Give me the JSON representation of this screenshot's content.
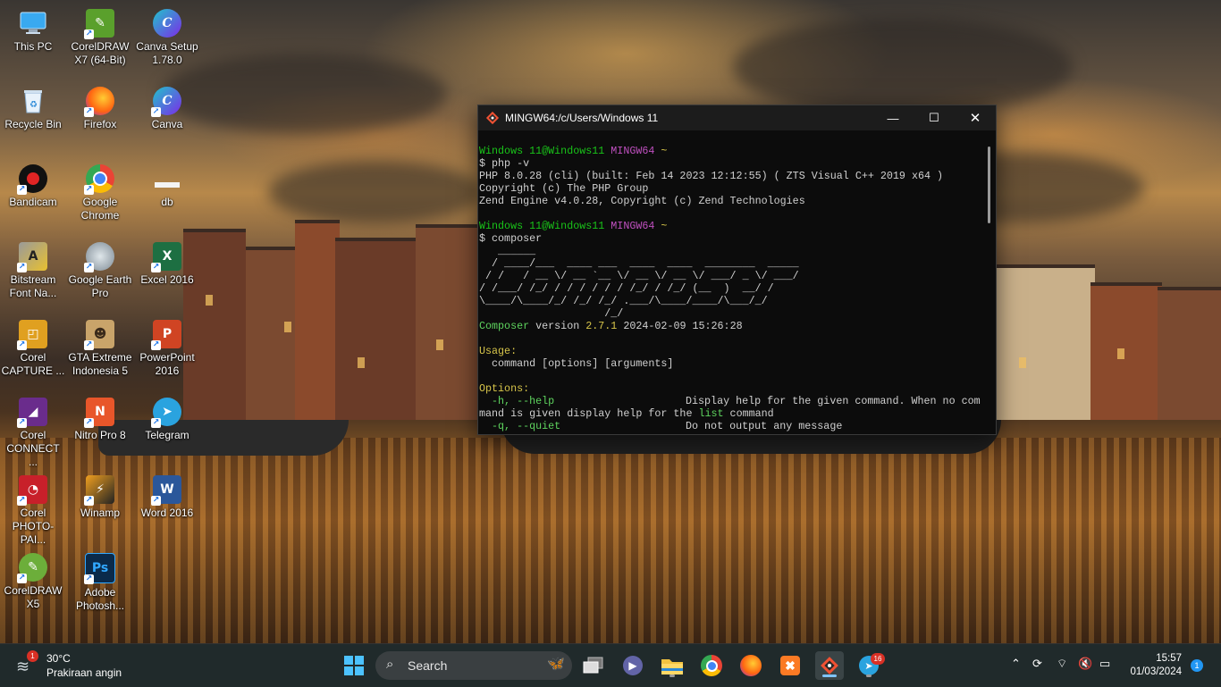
{
  "desktop": {
    "icons": [
      {
        "label": "This PC",
        "icon": "monitor-icon"
      },
      {
        "label": "CorelDRAW X7 (64-Bit)",
        "icon": "coreldraw-icon"
      },
      {
        "label": "Canva Setup 1.78.0",
        "icon": "canva-icon"
      },
      {
        "label": "Recycle Bin",
        "icon": "recycle-bin-icon"
      },
      {
        "label": "Firefox",
        "icon": "firefox-icon"
      },
      {
        "label": "Canva",
        "icon": "canva-icon"
      },
      {
        "label": "Bandicam",
        "icon": "bandicam-icon"
      },
      {
        "label": "Google Chrome",
        "icon": "chrome-icon"
      },
      {
        "label": "db",
        "icon": "file-icon"
      },
      {
        "label": "Bitstream Font Na...",
        "icon": "bitstream-icon"
      },
      {
        "label": "Google Earth Pro",
        "icon": "google-earth-icon"
      },
      {
        "label": "Excel 2016",
        "icon": "excel-icon"
      },
      {
        "label": "Corel CAPTURE ...",
        "icon": "corel-capture-icon"
      },
      {
        "label": "GTA Extreme Indonesia 5",
        "icon": "gta-icon"
      },
      {
        "label": "PowerPoint 2016",
        "icon": "powerpoint-icon"
      },
      {
        "label": "Corel CONNECT ...",
        "icon": "corel-connect-icon"
      },
      {
        "label": "Nitro Pro 8",
        "icon": "nitro-icon"
      },
      {
        "label": "Telegram",
        "icon": "telegram-icon"
      },
      {
        "label": "Corel PHOTO-PAI...",
        "icon": "corel-photopaint-icon"
      },
      {
        "label": "Winamp",
        "icon": "winamp-icon"
      },
      {
        "label": "Word 2016",
        "icon": "word-icon"
      },
      {
        "label": "CorelDRAW X5",
        "icon": "coreldraw-icon"
      },
      {
        "label": "Adobe Photosh...",
        "icon": "photoshop-icon"
      }
    ]
  },
  "terminal": {
    "title": "MINGW64:/c/Users/Windows 11",
    "prompt_user": "Windows 11@Windows11",
    "prompt_env": "MINGW64",
    "prompt_dir": "~",
    "cmd1": "$ php -v",
    "php_line1": "PHP 8.0.28 (cli) (built: Feb 14 2023 12:12:55) ( ZTS Visual C++ 2019 x64 )",
    "php_line2": "Copyright (c) The PHP Group",
    "php_line3": "Zend Engine v4.0.28, Copyright (c) Zend Technologies",
    "cmd2": "$ composer",
    "ascii": [
      "   ______",
      "  / ____/___  ____ ___  ____  ____  ________  _____",
      " / /   / __ \\/ __ `__ \\/ __ \\/ __ \\/ ___/ _ \\/ ___/",
      "/ /___/ /_/ / / / / / / /_/ / /_/ (__  )  __/ /",
      "\\____/\\____/_/ /_/ /_/ .___/\\____/____/\\___/_/",
      "                    /_/"
    ],
    "version_label": "Composer",
    "version_word": "version",
    "version_num": "2.7.1",
    "version_date": "2024-02-09 15:26:28",
    "usage_label": "Usage:",
    "usage_text": "  command [options] [arguments]",
    "options_label": "Options:",
    "opt1_flag": "  -h, --help",
    "opt1_desc": "Display help for the given command. When no com",
    "opt1_cont_a": "mand is given display help for the ",
    "opt1_cont_list": "list",
    "opt1_cont_b": " command",
    "opt2_flag": "  -q, --quiet",
    "opt2_desc": "Do not output any message"
  },
  "taskbar": {
    "weather_temp": "30°C",
    "weather_desc": "Prakiraan angin",
    "weather_badge": "1",
    "search_placeholder": "Search",
    "telegram_badge": "16",
    "time": "15:57",
    "date": "01/03/2024",
    "notification_count": "1"
  }
}
